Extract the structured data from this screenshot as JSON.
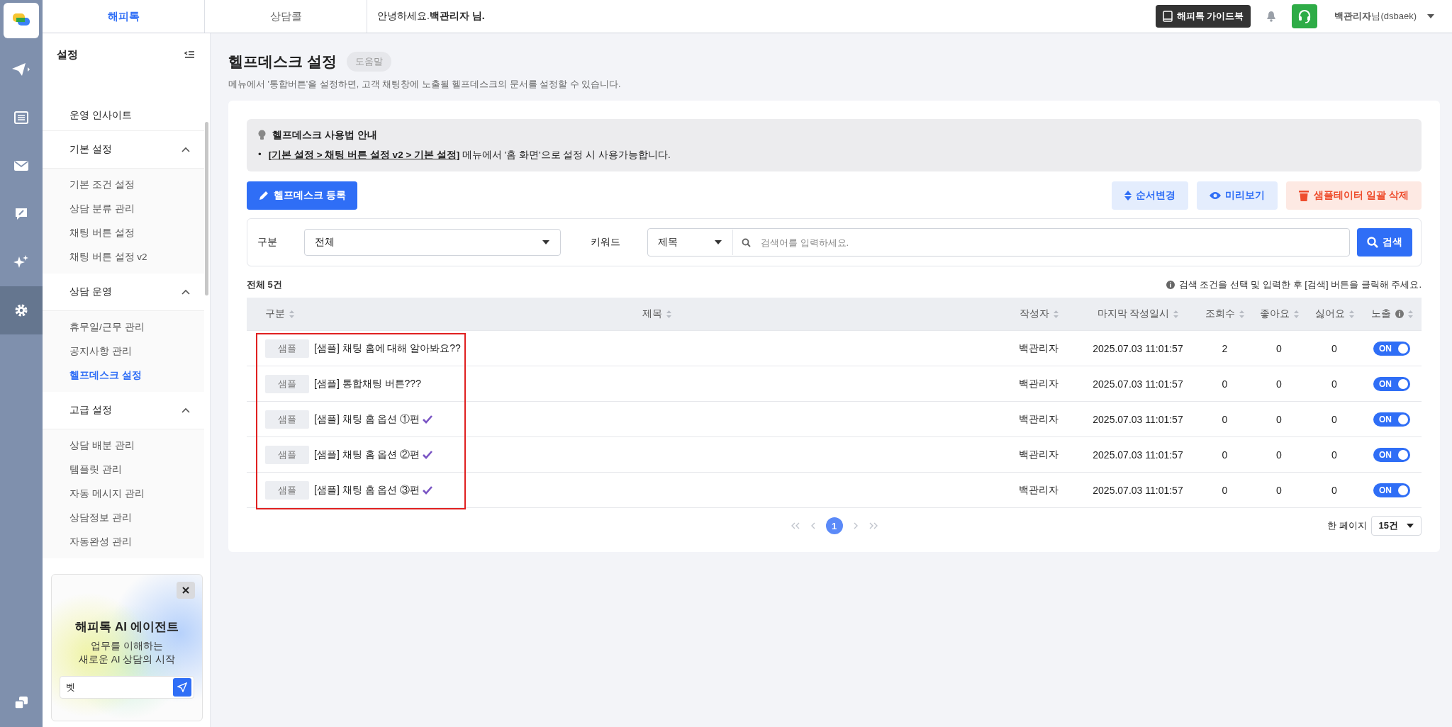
{
  "topbar": {
    "tabs": [
      {
        "label": "해피톡",
        "selected": true
      },
      {
        "label": "상담콜",
        "selected": false
      }
    ],
    "greeting": "안녕하세요.**백관리자 님.**",
    "guide_button": "해피톡 가이드북",
    "user": "**백관리자**님(dsbaek)"
  },
  "rail": {
    "items": [
      {
        "kind": "send",
        "selected": false
      },
      {
        "kind": "list",
        "selected": false
      },
      {
        "kind": "mail",
        "selected": false
      },
      {
        "kind": "chat",
        "selected": false
      },
      {
        "kind": "sparkle",
        "selected": false
      },
      {
        "kind": "gear",
        "selected": true
      }
    ]
  },
  "sidebar": {
    "title": "설정",
    "sections": [
      {
        "kind": "link",
        "label": "운영 인사이트"
      },
      {
        "kind": "group",
        "label": "기본 설정",
        "expanded": true,
        "items": [
          {
            "label": "기본 조건 설정",
            "selected": false
          },
          {
            "label": "상담 분류 관리",
            "selected": false
          },
          {
            "label": "채팅 버튼 설정",
            "selected": false
          },
          {
            "label": "채팅 버튼 설정 v2",
            "selected": false
          }
        ]
      },
      {
        "kind": "group",
        "label": "상담 운영",
        "expanded": true,
        "items": [
          {
            "label": "휴무일/근무 관리",
            "selected": false
          },
          {
            "label": "공지사항 관리",
            "selected": false
          },
          {
            "label": "헬프데스크 설정",
            "selected": true
          }
        ]
      },
      {
        "kind": "group",
        "label": "고급 설정",
        "expanded": true,
        "items": [
          {
            "label": "상담 배분 관리",
            "selected": false
          },
          {
            "label": "템플릿 관리",
            "selected": false
          },
          {
            "label": "자동 메시지 관리",
            "selected": false
          },
          {
            "label": "상담정보 관리",
            "selected": false
          },
          {
            "label": "자동완성 관리",
            "selected": false
          }
        ]
      }
    ]
  },
  "ai_promo": {
    "title": "해피톡 AI 에이전트",
    "subtitle": [
      "업무를 이해하는",
      "새로운 AI 상담의 시작"
    ],
    "input_value": "벳"
  },
  "page": {
    "title": "헬프데스크 설정",
    "help_badge": "도움말",
    "description": "메뉴에서 '통합버튼'을 설정하면, 고객 채팅창에 노출될 헬프데스크의 문서를 설정할 수 있습니다."
  },
  "notice": {
    "title": "헬프데스크 사용법 안내",
    "bullet": "•",
    "link": "[기본 설정 > 채팅 버튼 설정 v2 > 기본 설정]",
    "text": " 메뉴에서 '홈 화면'으로 설정 시 사용가능합니다."
  },
  "actions": {
    "register": "헬프데스크 등록",
    "reorder": "순서변경",
    "preview": "미리보기",
    "delete_samples": "샘플테이터 일괄 삭제"
  },
  "filters": {
    "category_label": "구분",
    "category_value": "전체",
    "keyword_label": "키워드",
    "keyword_field": "제목",
    "placeholder": "검색어를 입력하세요.",
    "search_button": "검색"
  },
  "total": "전체 5건",
  "hint": "검색 조건을 선택 및 입력한 후 [검색] 버튼을 클릭해 주세요.",
  "table": {
    "columns": [
      {
        "label": "구분"
      },
      {
        "label": "제목"
      },
      {
        "label": "작성자"
      },
      {
        "label": "마지막 작성일시"
      },
      {
        "label": "조회수"
      },
      {
        "label": "좋아요"
      },
      {
        "label": "싫어요"
      },
      {
        "label": "노출",
        "info": true
      }
    ],
    "rows": [
      {
        "tag": "샘플",
        "title": "[샘플] 채팅 홈에 대해 알아봐요??",
        "check": false,
        "author": "백관리자",
        "date": "2025.07.03 11:01:57",
        "views": "2",
        "likes": "0",
        "dislikes": "0",
        "toggle": "ON",
        "on": true
      },
      {
        "tag": "샘플",
        "title": "[샘플] 통합채팅 버튼???",
        "check": false,
        "author": "백관리자",
        "date": "2025.07.03 11:01:57",
        "views": "0",
        "likes": "0",
        "dislikes": "0",
        "toggle": "ON",
        "on": true
      },
      {
        "tag": "샘플",
        "title": "[샘플] 채팅 홈 옵션 ①편",
        "check": true,
        "author": "백관리자",
        "date": "2025.07.03 11:01:57",
        "views": "0",
        "likes": "0",
        "dislikes": "0",
        "toggle": "ON",
        "on": true
      },
      {
        "tag": "샘플",
        "title": "[샘플] 채팅 홈 옵션 ②편",
        "check": true,
        "author": "백관리자",
        "date": "2025.07.03 11:01:57",
        "views": "0",
        "likes": "0",
        "dislikes": "0",
        "toggle": "ON",
        "on": true
      },
      {
        "tag": "샘플",
        "title": "[샘플] 채팅 홈 옵션 ③편",
        "check": true,
        "author": "백관리자",
        "date": "2025.07.03 11:01:57",
        "views": "0",
        "likes": "0",
        "dislikes": "0",
        "toggle": "ON",
        "on": true
      }
    ],
    "highlight_frame": true
  },
  "pagination": {
    "pages": [
      {
        "label": "1",
        "selected": true
      }
    ],
    "per_page_label": "한 페이지",
    "per_page": "15건"
  }
}
